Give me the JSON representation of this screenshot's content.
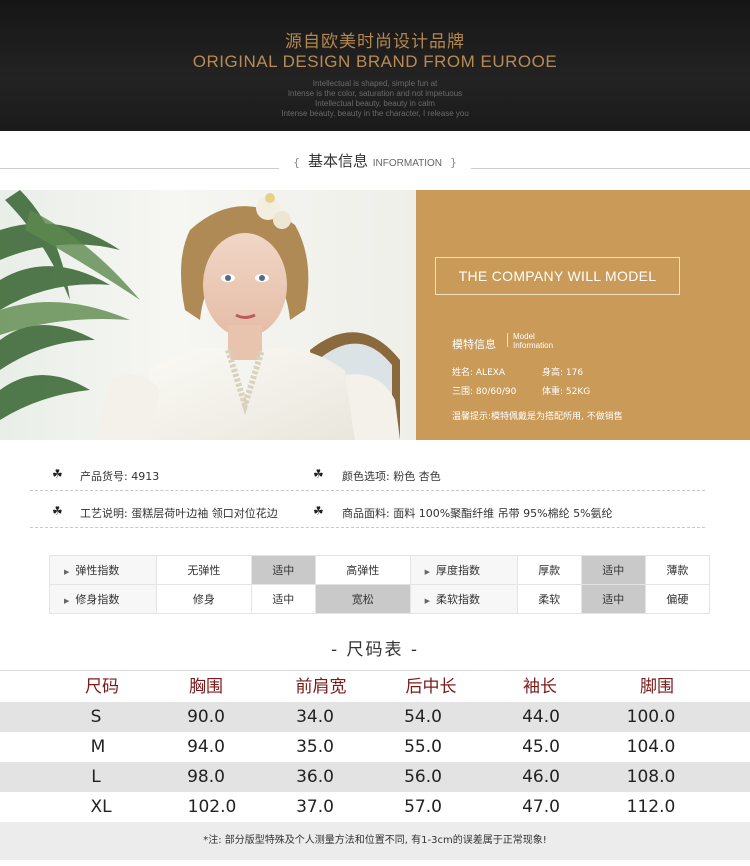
{
  "banner": {
    "title_cn": "源自欧美时尚设计品牌",
    "title_en": "ORIGINAL DESIGN BRAND FROM EUROOE",
    "taglines": [
      "Intellectual is shaped, simple fun at",
      "Intense is the color, saturation and not impetuous",
      "Intellectual beauty, beauty in calm",
      "Intense beauty, beauty in the character, I release you"
    ]
  },
  "section": {
    "open": "{",
    "title_cn": "基本信息",
    "title_en": "INFORMATION",
    "close": "}"
  },
  "model": {
    "box_text": "THE COMPANY WILL MODEL",
    "label_cn": "模特信息",
    "label_en_1": "Model",
    "label_en_2": "Information",
    "name": "姓名: ALEXA",
    "height": "身高: 176",
    "measurements": "三围: 80/60/90",
    "weight": "体重: 52KG",
    "tip": "温馨提示:模特佩戴是为搭配所用, 不做销售"
  },
  "product": {
    "clover": "☘",
    "code": "产品货号: 4913",
    "colors": "颜色选项: 粉色 杏色",
    "craft": "工艺说明: 蛋糕层荷叶边袖 领口对位花边",
    "fabric": "商品面料: 面料 100%聚酯纤维  吊带 95%棉纶 5%氨纶"
  },
  "attributes": {
    "arrow": "▶",
    "rows": [
      {
        "left_label": "弹性指数",
        "left_opts": [
          "无弹性",
          "适中",
          "高弹性"
        ],
        "left_sel": 1,
        "right_label": "厚度指数",
        "right_opts": [
          "厚款",
          "适中",
          "薄款"
        ],
        "right_sel": 1
      },
      {
        "left_label": "修身指数",
        "left_opts": [
          "修身",
          "适中",
          "宽松"
        ],
        "left_sel": 2,
        "right_label": "柔软指数",
        "right_opts": [
          "柔软",
          "适中",
          "偏硬"
        ],
        "right_sel": 1
      }
    ]
  },
  "size_chart": {
    "title": "- 尺码表 -",
    "headers": [
      "尺码",
      "胸围",
      "前肩宽",
      "后中长",
      "袖长",
      "脚围"
    ],
    "rows": [
      [
        "S",
        "90.0",
        "34.0",
        "54.0",
        "44.0",
        "100.0"
      ],
      [
        "M",
        "94.0",
        "35.0",
        "55.0",
        "45.0",
        "104.0"
      ],
      [
        "L",
        "98.0",
        "36.0",
        "56.0",
        "46.0",
        "108.0"
      ],
      [
        "XL",
        "102.0",
        "37.0",
        "57.0",
        "47.0",
        "112.0"
      ]
    ],
    "note": "*注: 部分版型特殊及个人测量方法和位置不同, 有1-3cm的误差属于正常现象!"
  },
  "colors": {
    "banner_gold": "#b98b53",
    "panel_tan": "#c99a58",
    "size_header_red": "#7b1a1a",
    "selected_gray": "#c9c9c9"
  }
}
